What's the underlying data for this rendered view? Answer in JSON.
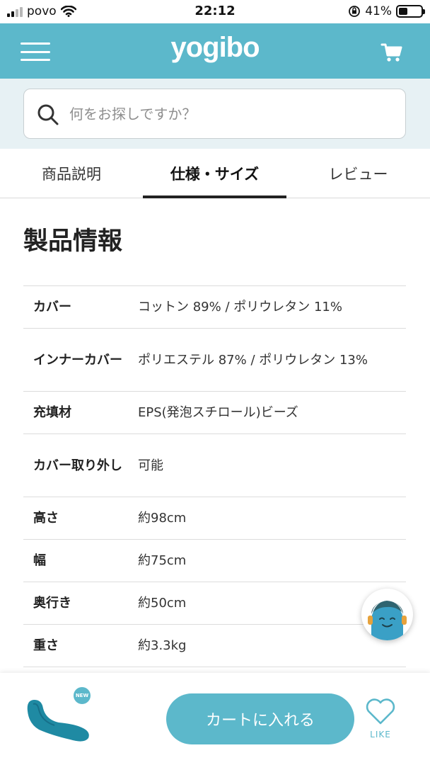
{
  "status_bar": {
    "carrier": "povo",
    "time": "22:12",
    "battery": "41%",
    "battery_level": 0.41
  },
  "header": {
    "logo": "yogibo",
    "menu_icon": "hamburger-icon",
    "cart_icon": "cart-icon"
  },
  "search": {
    "placeholder": "何をお探しですか？",
    "icon": "search-icon"
  },
  "tabs": [
    {
      "label": "商品説明",
      "active": false
    },
    {
      "label": "仕様・サイズ",
      "active": true
    },
    {
      "label": "レビュー",
      "active": false
    }
  ],
  "section": {
    "title": "製品情報"
  },
  "specs": [
    {
      "label": "カバー",
      "value": "コットン 89% / ポリウレタン 11%"
    },
    {
      "label": "インナーカバー",
      "value": "ポリエステル 87% / ポリウレタン 13%"
    },
    {
      "label": "充填材",
      "value": "EPS(発泡スチロール)ビーズ"
    },
    {
      "label": "カバー取り外し",
      "value": "可能"
    },
    {
      "label": "高さ",
      "value": "約98cm"
    },
    {
      "label": "幅",
      "value": "約75cm"
    },
    {
      "label": "奥行き",
      "value": "約50cm"
    },
    {
      "label": "重さ",
      "value": "約3.3kg"
    }
  ],
  "bottom_bar": {
    "badge": "NEW",
    "add_to_cart": "カートに入れる",
    "like": "LIKE"
  },
  "colors": {
    "brand": "#5cb8cb",
    "search_bg": "#e7f1f4",
    "product": "#1f8aa3"
  }
}
